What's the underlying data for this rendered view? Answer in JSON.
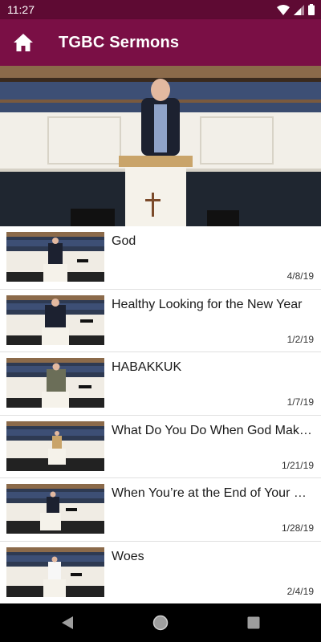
{
  "status_bar": {
    "time": "11:27",
    "icons": [
      "wifi-icon",
      "signal-icon",
      "battery-icon"
    ]
  },
  "app_bar": {
    "title": "TGBC Sermons",
    "icon": "home-icon"
  },
  "hero": {
    "image": "pastor-at-pulpit-video-still"
  },
  "sermons": [
    {
      "title": "God",
      "date": "4/8/19"
    },
    {
      "title": "Healthy Looking for the New Year",
      "date": "1/2/19"
    },
    {
      "title": "HABAKKUK",
      "date": "1/7/19"
    },
    {
      "title": "What Do You Do When God Makes...",
      "date": "1/21/19"
    },
    {
      "title": "When You’re at the End of Your Rope",
      "date": "1/28/19"
    },
    {
      "title": "Woes",
      "date": "2/4/19"
    }
  ],
  "nav_bar": {
    "icons": [
      "back-icon",
      "home-circle-icon",
      "recents-icon"
    ]
  },
  "colors": {
    "status_bar": "#5e0a33",
    "app_bar": "#7a0f45",
    "nav_bar": "#000000"
  }
}
